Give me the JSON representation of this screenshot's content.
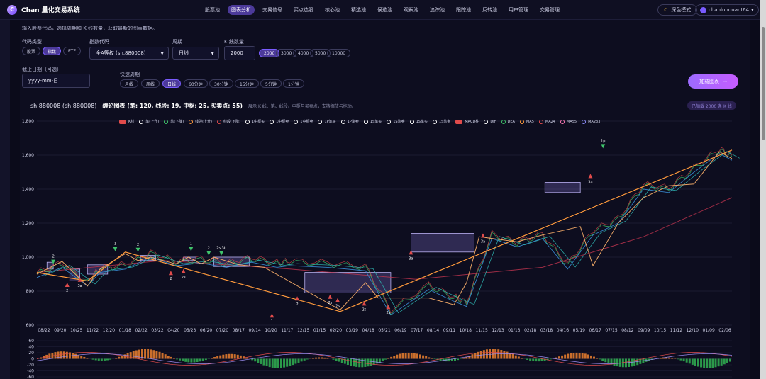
{
  "app": {
    "logo_letter": "C",
    "title": "Chan 量化交易系统"
  },
  "nav": [
    {
      "label": "股票池",
      "active": false
    },
    {
      "label": "图表分析",
      "active": true
    },
    {
      "label": "交易信号",
      "active": false
    },
    {
      "label": "买点选股",
      "active": false
    },
    {
      "label": "核心池",
      "active": false
    },
    {
      "label": "精选池",
      "active": false
    },
    {
      "label": "候选池",
      "active": false
    },
    {
      "label": "观察池",
      "active": false
    },
    {
      "label": "追踪池",
      "active": false
    },
    {
      "label": "跟踪池",
      "active": false
    },
    {
      "label": "反转池",
      "active": false
    },
    {
      "label": "用户管理",
      "active": false
    },
    {
      "label": "交易管理",
      "active": false
    }
  ],
  "header_right": {
    "dark_mode": "深色模式",
    "user": "chanlunquant64"
  },
  "form": {
    "description": "输入股票代码，选择周期和 K 线数量，获取最新的图表数据。",
    "code_type_label": "代码类型",
    "code_types": [
      {
        "label": "股票",
        "active": false
      },
      {
        "label": "指数",
        "active": true
      },
      {
        "label": "ETF",
        "active": false
      }
    ],
    "index_code_label": "指数代码",
    "index_code_value": "全A等权 (sh.880008)",
    "period_label": "周期",
    "period_value": "日线",
    "k_count_label": "K 线数量",
    "k_count_value": "2000",
    "k_count_options": [
      {
        "label": "2000",
        "active": true
      },
      {
        "label": "3000",
        "active": false
      },
      {
        "label": "4000",
        "active": false
      },
      {
        "label": "5000",
        "active": false
      },
      {
        "label": "10000",
        "active": false
      }
    ],
    "end_date_label": "截止日期（可选）",
    "end_date_placeholder": "yyyy-mm-日",
    "quick_period_label": "快速周期",
    "quick_periods": [
      {
        "label": "月线",
        "active": false
      },
      {
        "label": "周线",
        "active": false
      },
      {
        "label": "日线",
        "active": true
      },
      {
        "label": "60分钟",
        "active": false
      },
      {
        "label": "30分钟",
        "active": false
      },
      {
        "label": "15分钟",
        "active": false
      },
      {
        "label": "5分钟",
        "active": false
      },
      {
        "label": "1分钟",
        "active": false
      }
    ],
    "load_button": "加载图表",
    "load_status": "已加载 2000 条 K 线"
  },
  "chart_header": {
    "symbol": "sh.880008 (sh.880008)",
    "title": "缠论图表 (笔: 120, 线段: 19, 中枢: 25, 买卖点: 55)",
    "subtitle": "展示 K 线、笔、线段、中枢与买卖点，支持缩放与拖动。"
  },
  "legend": [
    {
      "label": "K线",
      "kind": "swatch",
      "color": "#e04b4b"
    },
    {
      "label": "笔(上升)",
      "kind": "dot",
      "color": "#ffffff"
    },
    {
      "label": "笔(下降)",
      "kind": "dot",
      "color": "#3fc46b"
    },
    {
      "label": "线段(上升)",
      "kind": "dot",
      "color": "#ff9a3c"
    },
    {
      "label": "线段(下降)",
      "kind": "dot",
      "color": "#e04b4b"
    },
    {
      "label": "1中枢买",
      "kind": "dot",
      "color": "#ffffff"
    },
    {
      "label": "1中枢卖",
      "kind": "dot",
      "color": "#ffffff"
    },
    {
      "label": "1中枢卖",
      "kind": "dot",
      "color": "#ffffff"
    },
    {
      "label": "1P笔买",
      "kind": "dot",
      "color": "#ffffff"
    },
    {
      "label": "1P笔卖",
      "kind": "dot",
      "color": "#ffffff"
    },
    {
      "label": "1S笔买",
      "kind": "dot",
      "color": "#ffffff"
    },
    {
      "label": "1S笔卖",
      "kind": "dot",
      "color": "#ffffff"
    },
    {
      "label": "1S笔买",
      "kind": "dot",
      "color": "#ffffff"
    },
    {
      "label": "1S笔卖",
      "kind": "dot",
      "color": "#ffffff"
    },
    {
      "label": "MACD柱",
      "kind": "swatch",
      "color": "#e04b4b"
    },
    {
      "label": "DIF",
      "kind": "dot",
      "color": "#ffffff"
    },
    {
      "label": "DEA",
      "kind": "dot",
      "color": "#3fc46b"
    },
    {
      "label": "MA5",
      "kind": "dot",
      "color": "#ff9a3c"
    },
    {
      "label": "MA24",
      "kind": "dot",
      "color": "#e04b4b"
    },
    {
      "label": "MA55",
      "kind": "dot",
      "color": "#ff7ab6"
    },
    {
      "label": "MA233",
      "kind": "dot",
      "color": "#8f8fff"
    }
  ],
  "colors": {
    "background": "#0b0b1a",
    "accent": "#7a5cff",
    "up": "#e04b4b",
    "down": "#3fc46b",
    "segment": "#ff9a3c",
    "zone_fill": "#8a78d8"
  },
  "chart_data": {
    "type": "line",
    "y_ticks": [
      600,
      800,
      "1,000",
      "1,200",
      "1,400",
      "1,600",
      "1,800"
    ],
    "ylim": [
      600,
      1800
    ],
    "x_ticks": [
      "08/22",
      "09/20",
      "10/25",
      "11/22",
      "12/20",
      "01/18",
      "02/22",
      "03/22",
      "04/20",
      "05/23",
      "06/20",
      "07/20",
      "08/17",
      "09/14",
      "10/20",
      "11/17",
      "12/15",
      "01/15",
      "02/20",
      "03/19",
      "04/18",
      "05/21",
      "06/19",
      "07/17",
      "08/14",
      "09/11",
      "10/18",
      "11/15",
      "12/13",
      "01/13",
      "02/18",
      "03/18",
      "04/16",
      "05/19",
      "06/17",
      "07/15",
      "08/12",
      "09/09",
      "10/15",
      "11/12",
      "12/10",
      "01/09",
      "02/06"
    ],
    "price_path": [
      [
        0,
        900
      ],
      [
        2,
        960
      ],
      [
        4,
        850
      ],
      [
        5,
        930
      ],
      [
        7,
        950
      ],
      [
        9,
        1020
      ],
      [
        11,
        970
      ],
      [
        13,
        985
      ],
      [
        15,
        960
      ],
      [
        17,
        990
      ],
      [
        19,
        960
      ],
      [
        20,
        970
      ],
      [
        23,
        960
      ],
      [
        26,
        940
      ],
      [
        28,
        680
      ],
      [
        31,
        830
      ],
      [
        33,
        760
      ],
      [
        34,
        730
      ],
      [
        36,
        1130
      ],
      [
        38,
        1080
      ],
      [
        40,
        1130
      ],
      [
        42,
        950
      ],
      [
        44,
        1150
      ],
      [
        46,
        1220
      ],
      [
        48,
        1420
      ],
      [
        50,
        1400
      ],
      [
        52,
        1520
      ],
      [
        54,
        1630
      ],
      [
        55,
        1590
      ]
    ],
    "bi_path": [
      [
        0,
        900
      ],
      [
        2,
        975
      ],
      [
        4,
        830
      ],
      [
        5,
        930
      ],
      [
        7,
        1020
      ],
      [
        8,
        980
      ],
      [
        9,
        1000
      ],
      [
        11,
        960
      ],
      [
        12,
        1000
      ],
      [
        13,
        960
      ],
      [
        14,
        1000
      ],
      [
        16,
        955
      ],
      [
        18,
        940
      ],
      [
        24,
        690
      ],
      [
        26,
        850
      ],
      [
        27,
        760
      ],
      [
        31,
        760
      ],
      [
        33,
        720
      ],
      [
        34,
        850
      ],
      [
        35,
        1120
      ],
      [
        38,
        1090
      ],
      [
        40,
        1130
      ],
      [
        43,
        1180
      ],
      [
        44,
        950
      ],
      [
        46,
        1200
      ],
      [
        48,
        1350
      ],
      [
        50,
        1420
      ],
      [
        52,
        1430
      ],
      [
        54,
        1620
      ],
      [
        55,
        1580
      ]
    ],
    "segment_path": [
      [
        0,
        910
      ],
      [
        4,
        860
      ],
      [
        7,
        1030
      ],
      [
        24,
        680
      ],
      [
        55,
        1630
      ]
    ],
    "ma233": [
      [
        0,
        910
      ],
      [
        10,
        980
      ],
      [
        20,
        930
      ],
      [
        30,
        870
      ],
      [
        40,
        940
      ],
      [
        48,
        1120
      ],
      [
        55,
        1350
      ]
    ],
    "zones": [
      {
        "x0": 0.8,
        "x1": 1.3,
        "y0": 930,
        "y1": 970
      },
      {
        "x0": 2.6,
        "x1": 3.4,
        "y0": 860,
        "y1": 930
      },
      {
        "x0": 4.0,
        "x1": 5.6,
        "y0": 900,
        "y1": 955
      },
      {
        "x0": 8.2,
        "x1": 9.4,
        "y0": 980,
        "y1": 1010
      },
      {
        "x0": 11.6,
        "x1": 12.6,
        "y0": 980,
        "y1": 1000
      },
      {
        "x0": 14.0,
        "x1": 16.8,
        "y0": 945,
        "y1": 1000
      },
      {
        "x0": 21.2,
        "x1": 28.0,
        "y0": 790,
        "y1": 910
      },
      {
        "x0": 29.6,
        "x1": 34.6,
        "y0": 1030,
        "y1": 1140
      },
      {
        "x0": 40.2,
        "x1": 43.0,
        "y0": 1380,
        "y1": 1440
      }
    ],
    "signals": [
      {
        "x": 1.3,
        "y": 960,
        "label": "2",
        "dir": "sell"
      },
      {
        "x": 2.4,
        "y": 850,
        "label": "2",
        "dir": "buy"
      },
      {
        "x": 3.4,
        "y": 880,
        "label": "3a",
        "dir": "buy"
      },
      {
        "x": 6.2,
        "y": 1035,
        "label": "1",
        "dir": "sell"
      },
      {
        "x": 8.0,
        "y": 1030,
        "label": "2",
        "dir": "sell"
      },
      {
        "x": 10.6,
        "y": 920,
        "label": "2",
        "dir": "buy"
      },
      {
        "x": 11.6,
        "y": 930,
        "label": "2s",
        "dir": "buy"
      },
      {
        "x": 12.2,
        "y": 1035,
        "label": "1",
        "dir": "sell"
      },
      {
        "x": 13.6,
        "y": 1010,
        "label": "2",
        "dir": "sell"
      },
      {
        "x": 14.6,
        "y": 1010,
        "label": "2s,3b",
        "dir": "sell"
      },
      {
        "x": 18.6,
        "y": 670,
        "label": "1",
        "dir": "buy"
      },
      {
        "x": 20.6,
        "y": 770,
        "label": "2",
        "dir": "buy"
      },
      {
        "x": 23.2,
        "y": 780,
        "label": "2s",
        "dir": "buy"
      },
      {
        "x": 23.8,
        "y": 760,
        "label": "2s",
        "dir": "buy"
      },
      {
        "x": 25.9,
        "y": 740,
        "label": "2s",
        "dir": "buy"
      },
      {
        "x": 27.8,
        "y": 720,
        "label": "2s",
        "dir": "buy"
      },
      {
        "x": 29.6,
        "y": 1040,
        "label": "3a",
        "dir": "buy"
      },
      {
        "x": 35.3,
        "y": 1140,
        "label": "3a",
        "dir": "buy"
      },
      {
        "x": 43.8,
        "y": 1490,
        "label": "3a",
        "dir": "buy"
      },
      {
        "x": 44.8,
        "y": 1640,
        "label": "1p",
        "dir": "sell"
      }
    ],
    "macd_ticks": [
      60,
      40,
      20,
      0,
      -20,
      -40,
      -60
    ]
  }
}
